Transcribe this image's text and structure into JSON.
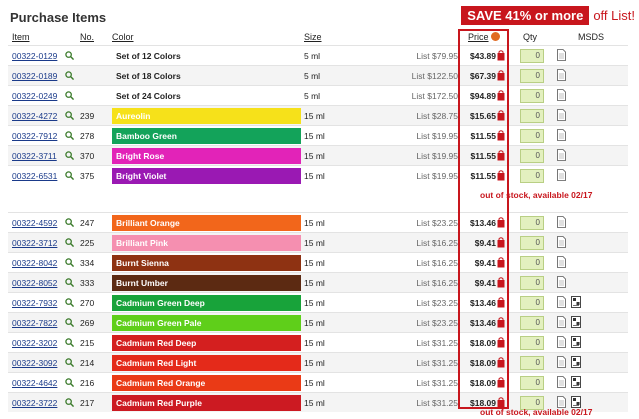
{
  "page_title": "Purchase Items",
  "promo": {
    "badge": "SAVE 41% or more",
    "tail": "off List!",
    "color": "#c8161d"
  },
  "columns": {
    "item": "Item",
    "no": "No.",
    "color": "Color",
    "size": "Size",
    "price": "Price",
    "qty": "Qty",
    "msds": "MSDS"
  },
  "notes": {
    "out_of_stock_1": "out of stock, available 02/17",
    "out_of_stock_2": "out of stock, available 02/17"
  },
  "rows_a": [
    {
      "item": "00322-0129",
      "no": "",
      "color": "Set of 12 Colors",
      "swatch": "",
      "size": "5 ml",
      "list": "List $79.95",
      "price": "$43.89",
      "qty": "0",
      "msds2": false
    },
    {
      "item": "00322-0189",
      "no": "",
      "color": "Set of 18 Colors",
      "swatch": "",
      "size": "5 ml",
      "list": "List $122.50",
      "price": "$67.39",
      "qty": "0",
      "msds2": false
    },
    {
      "item": "00322-0249",
      "no": "",
      "color": "Set of 24 Colors",
      "swatch": "",
      "size": "5 ml",
      "list": "List $172.50",
      "price": "$94.89",
      "qty": "0",
      "msds2": false
    },
    {
      "item": "00322-4272",
      "no": "239",
      "color": "Aureolin",
      "swatch": "#f6e11a",
      "size": "15 ml",
      "list": "List $28.75",
      "price": "$15.65",
      "qty": "0",
      "msds2": false
    },
    {
      "item": "00322-7912",
      "no": "278",
      "color": "Bamboo Green",
      "swatch": "#13a35a",
      "size": "15 ml",
      "list": "List $19.95",
      "price": "$11.55",
      "qty": "0",
      "msds2": false
    },
    {
      "item": "00322-3711",
      "no": "370",
      "color": "Bright Rose",
      "swatch": "#e223b8",
      "size": "15 ml",
      "list": "List $19.95",
      "price": "$11.55",
      "qty": "0",
      "msds2": false
    },
    {
      "item": "00322-6531",
      "no": "375",
      "color": "Bright Violet",
      "swatch": "#9a19b3",
      "size": "15 ml",
      "list": "List $19.95",
      "price": "$11.55",
      "qty": "0",
      "msds2": false
    }
  ],
  "rows_b": [
    {
      "item": "00322-4592",
      "no": "247",
      "color": "Brilliant Orange",
      "swatch": "#f2661b",
      "size": "15 ml",
      "list": "List $23.25",
      "price": "$13.46",
      "qty": "0",
      "msds2": false
    },
    {
      "item": "00322-3712",
      "no": "225",
      "color": "Brilliant Pink",
      "swatch": "#f58fb0",
      "size": "15 ml",
      "list": "List $16.25",
      "price": "$9.41",
      "qty": "0",
      "msds2": false
    },
    {
      "item": "00322-8042",
      "no": "334",
      "color": "Burnt Sienna",
      "swatch": "#8e3212",
      "size": "15 ml",
      "list": "List $16.25",
      "price": "$9.41",
      "qty": "0",
      "msds2": false
    },
    {
      "item": "00322-8052",
      "no": "333",
      "color": "Burnt Umber",
      "swatch": "#5c2a12",
      "size": "15 ml",
      "list": "List $16.25",
      "price": "$9.41",
      "qty": "0",
      "msds2": false
    },
    {
      "item": "00322-7932",
      "no": "270",
      "color": "Cadmium Green Deep",
      "swatch": "#18a33a",
      "size": "15 ml",
      "list": "List $23.25",
      "price": "$13.46",
      "qty": "0",
      "msds2": true
    },
    {
      "item": "00322-7822",
      "no": "269",
      "color": "Cadmium Green Pale",
      "swatch": "#5fcf1a",
      "size": "15 ml",
      "list": "List $23.25",
      "price": "$13.46",
      "qty": "0",
      "msds2": true
    },
    {
      "item": "00322-3202",
      "no": "215",
      "color": "Cadmium Red Deep",
      "swatch": "#d41f1f",
      "size": "15 ml",
      "list": "List $31.25",
      "price": "$18.09",
      "qty": "0",
      "msds2": true
    },
    {
      "item": "00322-3092",
      "no": "214",
      "color": "Cadmium Red Light",
      "swatch": "#e42a1a",
      "size": "15 ml",
      "list": "List $31.25",
      "price": "$18.09",
      "qty": "0",
      "msds2": true
    },
    {
      "item": "00322-4642",
      "no": "216",
      "color": "Cadmium Red Orange",
      "swatch": "#ea3a16",
      "size": "15 ml",
      "list": "List $31.25",
      "price": "$18.09",
      "qty": "0",
      "msds2": true
    },
    {
      "item": "00322-3722",
      "no": "217",
      "color": "Cadmium Red Purple",
      "swatch": "#cc1a22",
      "size": "15 ml",
      "list": "List $31.25",
      "price": "$18.09",
      "qty": "0",
      "msds2": true
    }
  ]
}
